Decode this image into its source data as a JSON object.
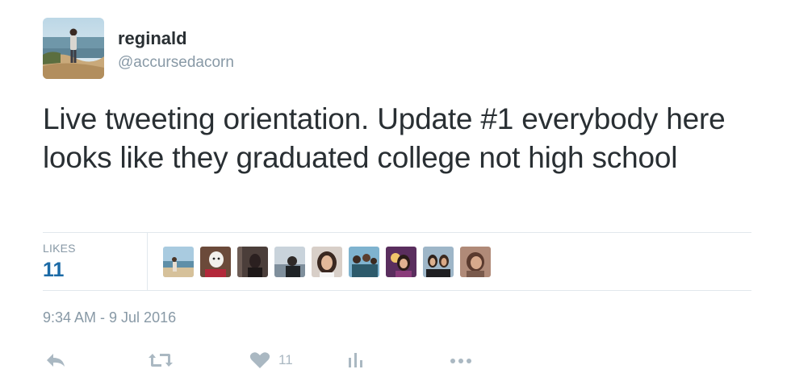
{
  "user": {
    "display_name": "reginald",
    "screen_name": "@accursedacorn",
    "avatar_icon": "profile-photo-person-on-coast"
  },
  "tweet": {
    "text": "Live tweeting orientation. Update #1 everybody here looks like they graduated college not high school",
    "timestamp": "9:34 AM - 9 Jul 2016"
  },
  "stats": {
    "likes_label": "LIKES",
    "likes_count": "11",
    "liker_avatar_count_shown": 9
  },
  "actions": {
    "reply_icon": "reply-icon",
    "retweet_icon": "retweet-icon",
    "like_icon": "heart-icon",
    "like_count": "11",
    "analytics_icon": "analytics-icon",
    "more_icon": "more-icon"
  },
  "colors": {
    "text": "#292f33",
    "muted": "#8899a6",
    "link_blue": "#1b6aa6",
    "icon_gray": "#aab8c2",
    "divider": "#e1e8ed"
  }
}
